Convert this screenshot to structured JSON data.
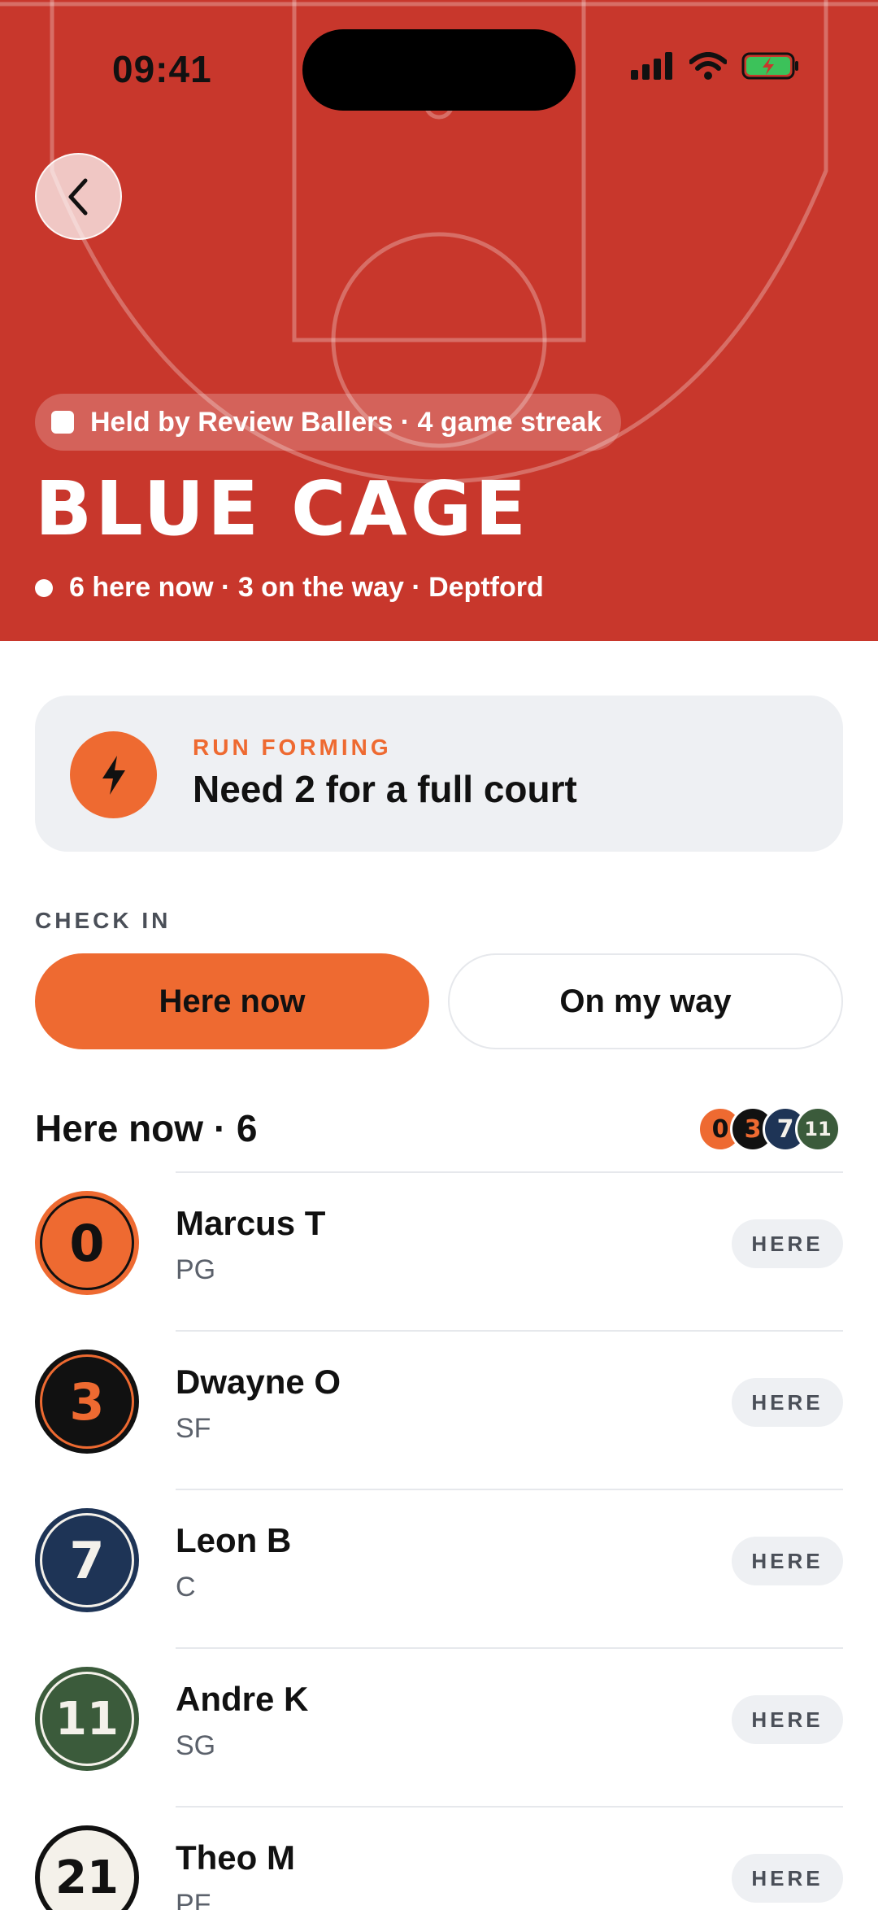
{
  "status_bar": {
    "time": "09:41"
  },
  "hero": {
    "held_by": "Held by Review Ballers · 4 game streak",
    "title": "BLUE CAGE",
    "presence": "6 here now · 3 on the way · Deptford",
    "background": "#c8372c"
  },
  "run_card": {
    "kicker": "RUN FORMING",
    "title": "Need 2 for a full court",
    "icon": "bolt-icon"
  },
  "check_in": {
    "label": "CHECK IN",
    "here_now": "Here now",
    "on_my_way": "On my way"
  },
  "list": {
    "heading": "Here now · 6",
    "players": [
      {
        "number": "0",
        "name": "Marcus T",
        "position": "PG",
        "status": "HERE"
      },
      {
        "number": "3",
        "name": "Dwayne O",
        "position": "SF",
        "status": "HERE"
      },
      {
        "number": "7",
        "name": "Leon B",
        "position": "C",
        "status": "HERE"
      },
      {
        "number": "11",
        "name": "Andre K",
        "position": "SG",
        "status": "HERE"
      },
      {
        "number": "21",
        "name": "Theo M",
        "position": "PF",
        "status": "HERE"
      }
    ]
  },
  "colors": {
    "accent": "#ee6a31",
    "hero_red": "#c8372c",
    "navy": "#1e3456",
    "green": "#3b5b3b",
    "black": "#111111",
    "cream": "#f4f1ea"
  }
}
